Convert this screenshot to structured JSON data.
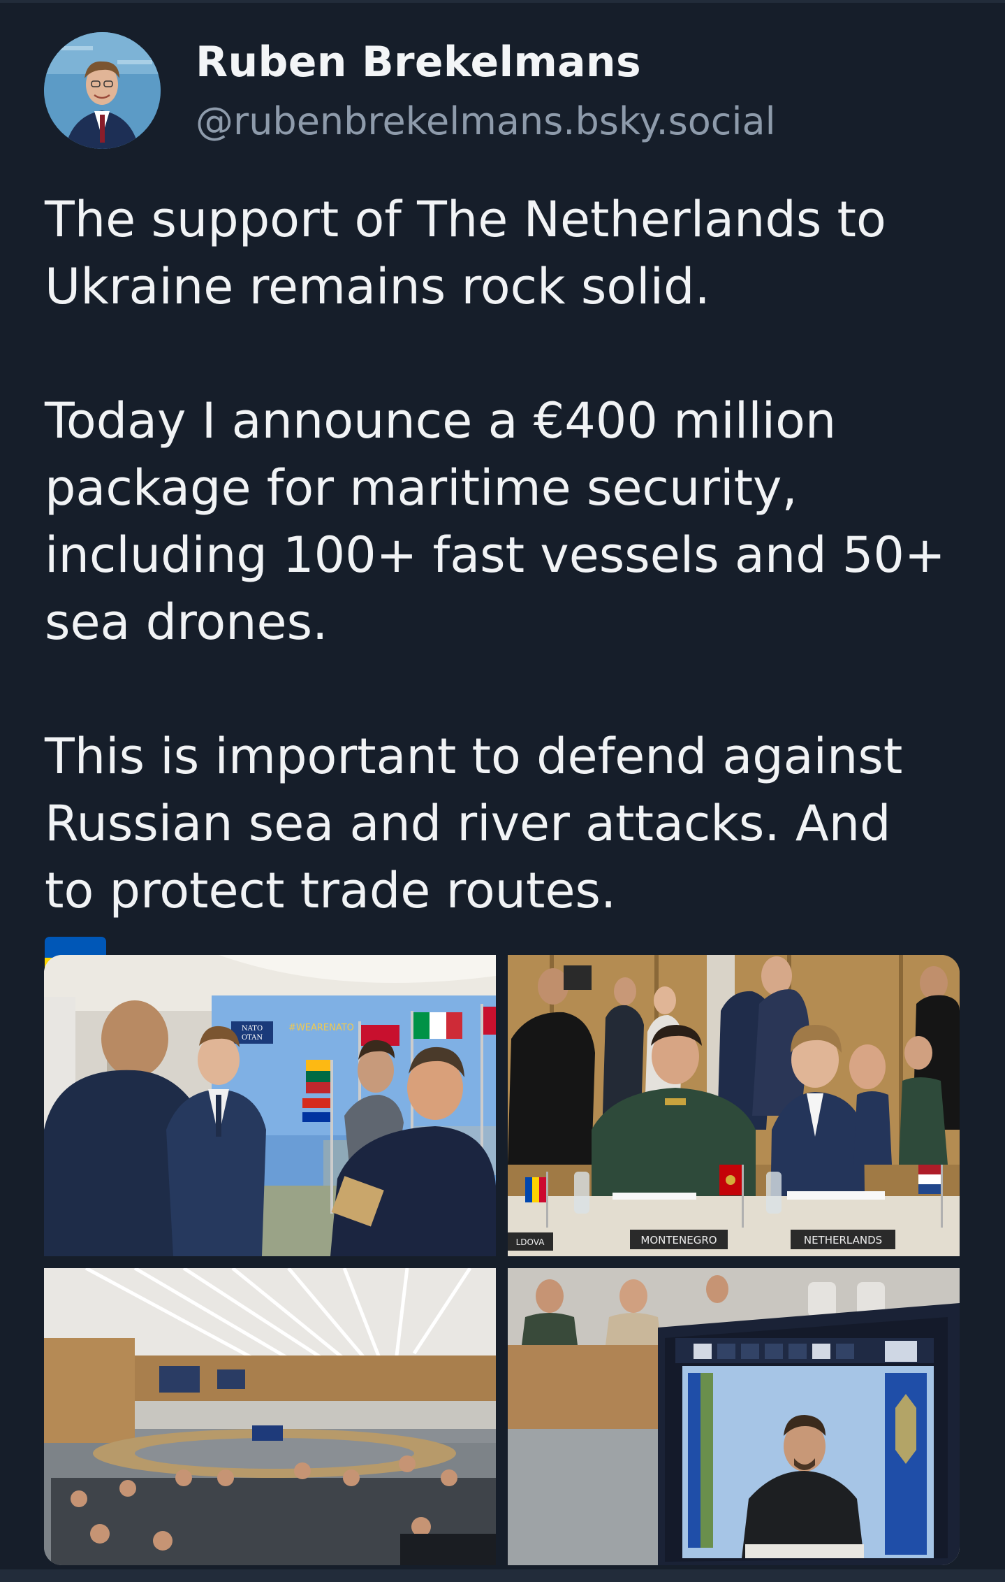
{
  "author": {
    "display_name": "Ruben Brekelmans",
    "handle": "@rubenbrekelmans.bsky.social"
  },
  "post": {
    "lines": [
      "The support of The Netherlands to",
      "Ukraine remains rock solid.",
      "",
      "Today I announce a €400 million",
      "package for maritime security,",
      "including 100+ fast vessels and 50+",
      "sea drones.",
      "",
      "This is important to defend against",
      "Russian sea and river attacks. And",
      "to protect trade routes."
    ],
    "emoji": [
      "netherlands-flag",
      "ukraine-flag"
    ]
  },
  "images": {
    "photo1": {
      "backdrop_text": "#WEARENATO",
      "logo_text_1": "NATO",
      "logo_text_2": "OTAN"
    },
    "photo2": {
      "nameplate_1": "MONTENEGRO",
      "nameplate_2": "NETHERLANDS",
      "nameplate_3": "LDOVA"
    },
    "photo3": {},
    "photo4": {}
  },
  "colors": {
    "background": "#161e2a",
    "text": "#f1f3f5",
    "handle": "#8e9bab",
    "nl_red": "#ae1c28",
    "nl_blue": "#21468b",
    "ua_blue": "#0057b7",
    "ua_yellow": "#ffd700"
  }
}
